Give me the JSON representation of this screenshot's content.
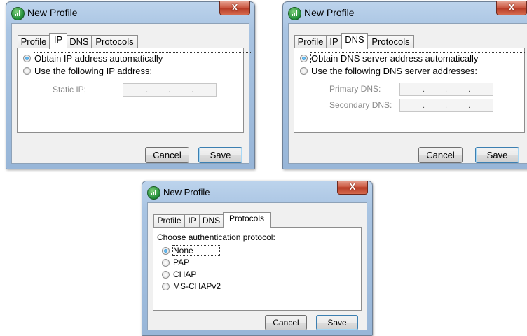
{
  "dialogs": {
    "ip": {
      "title": "New Profile",
      "close_glyph": "X",
      "tabs": [
        "Profile",
        "IP",
        "DNS",
        "Protocols"
      ],
      "active_tab": "IP",
      "options": [
        {
          "label": "Obtain IP address automatically",
          "checked": true
        },
        {
          "label": "Use the following IP address:",
          "checked": false
        }
      ],
      "static_ip_label": "Static IP:",
      "buttons": {
        "cancel": "Cancel",
        "save": "Save"
      }
    },
    "dns": {
      "title": "New Profile",
      "close_glyph": "X",
      "tabs": [
        "Profile",
        "IP",
        "DNS",
        "Protocols"
      ],
      "active_tab": "DNS",
      "options": [
        {
          "label": "Obtain DNS server address automatically",
          "checked": true
        },
        {
          "label": "Use the following DNS server addresses:",
          "checked": false
        }
      ],
      "primary_dns_label": "Primary DNS:",
      "secondary_dns_label": "Secondary DNS:",
      "buttons": {
        "cancel": "Cancel",
        "save": "Save"
      }
    },
    "protocols": {
      "title": "New Profile",
      "close_glyph": "X",
      "tabs": [
        "Profile",
        "IP",
        "DNS",
        "Protocols"
      ],
      "active_tab": "Protocols",
      "prompt": "Choose authentication protocol:",
      "options": [
        {
          "label": "None",
          "checked": true
        },
        {
          "label": "PAP",
          "checked": false
        },
        {
          "label": "CHAP",
          "checked": false
        },
        {
          "label": "MS-CHAPv2",
          "checked": false
        }
      ],
      "buttons": {
        "cancel": "Cancel",
        "save": "Save"
      }
    }
  },
  "ip_placeholder_dots": "."
}
